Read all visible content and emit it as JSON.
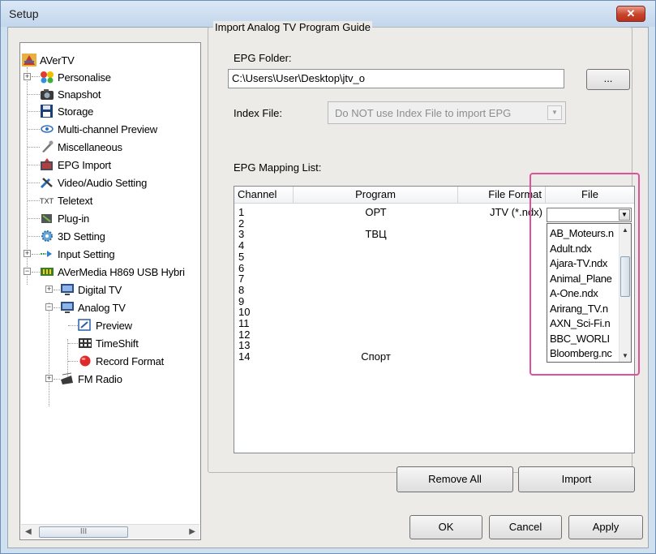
{
  "window": {
    "title": "Setup",
    "close_label": "✕"
  },
  "tree": {
    "items": [
      {
        "label": "AVerTV"
      },
      {
        "label": "Personalise"
      },
      {
        "label": "Snapshot"
      },
      {
        "label": "Storage"
      },
      {
        "label": "Multi-channel Preview"
      },
      {
        "label": "Miscellaneous"
      },
      {
        "label": "EPG Import"
      },
      {
        "label": "Video/Audio Setting"
      },
      {
        "label": "Teletext"
      },
      {
        "label": "Plug-in"
      },
      {
        "label": "3D Setting"
      },
      {
        "label": "Input Setting"
      },
      {
        "label": "AVerMedia H869 USB Hybri"
      },
      {
        "label": "Digital TV"
      },
      {
        "label": "Analog TV"
      },
      {
        "label": "Preview"
      },
      {
        "label": "TimeShift"
      },
      {
        "label": "Record Format"
      },
      {
        "label": "FM Radio"
      }
    ],
    "scroll_thumb_label": "III"
  },
  "group": {
    "title": "Import Analog TV Program Guide",
    "epg_folder_label": "EPG Folder:",
    "epg_folder_value": "C:\\Users\\User\\Desktop\\jtv_o",
    "browse_label": "...",
    "index_file_label": "Index File:",
    "index_file_value": "Do NOT use Index File to import EPG",
    "mapping_label": "EPG Mapping List:"
  },
  "mapping_list": {
    "columns": [
      "Channel",
      "Program",
      "File Format",
      "File"
    ],
    "rows": [
      {
        "channel": "1",
        "program": "ОРТ",
        "format": "JTV (*.ndx)"
      },
      {
        "channel": "2",
        "program": "",
        "format": ""
      },
      {
        "channel": "3",
        "program": "ТВЦ",
        "format": ""
      },
      {
        "channel": "4",
        "program": "",
        "format": ""
      },
      {
        "channel": "5",
        "program": "",
        "format": ""
      },
      {
        "channel": "6",
        "program": "",
        "format": ""
      },
      {
        "channel": "7",
        "program": "",
        "format": ""
      },
      {
        "channel": "8",
        "program": "",
        "format": ""
      },
      {
        "channel": "9",
        "program": "",
        "format": ""
      },
      {
        "channel": "10",
        "program": "",
        "format": ""
      },
      {
        "channel": "11",
        "program": "",
        "format": ""
      },
      {
        "channel": "12",
        "program": "",
        "format": ""
      },
      {
        "channel": "13",
        "program": "",
        "format": ""
      },
      {
        "channel": "14",
        "program": "Спорт",
        "format": ""
      }
    ]
  },
  "file_dropdown": {
    "selected": "",
    "options": [
      "AB_Moteurs.n",
      "Adult.ndx",
      "Ajara-TV.ndx",
      "Animal_Plane",
      "A-One.ndx",
      "Arirang_TV.n",
      "AXN_Sci-Fi.n",
      "BBC_WORLI",
      "Bloomberg.nc"
    ]
  },
  "buttons": {
    "remove_all": "Remove All",
    "import": "Import",
    "ok": "OK",
    "cancel": "Cancel",
    "apply": "Apply"
  },
  "colors": {
    "highlight": "#e0519b",
    "window_frame": "#cfe0f0",
    "dialog_bg": "#ecebe7"
  }
}
